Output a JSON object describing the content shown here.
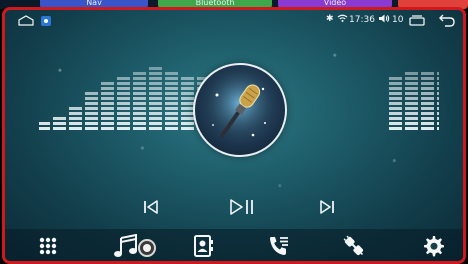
{
  "top_tabs": [
    {
      "label": "Nav"
    },
    {
      "label": "Bluetooth"
    },
    {
      "label": "Video"
    }
  ],
  "status_bar": {
    "time": "17:36",
    "volume_level": "10",
    "icons": [
      "home-icon",
      "app-badge-icon",
      "bluetooth-icon",
      "wifi-icon",
      "volume-icon",
      "recents-icon",
      "back-icon"
    ]
  },
  "player": {
    "album_art": "microphone-album-art",
    "controls": [
      "previous-track-icon",
      "play-pause-icon",
      "next-track-icon"
    ]
  },
  "dock": {
    "items": [
      "apps-grid-icon",
      "music-icon",
      "contacts-icon",
      "call-log-icon",
      "phone-link-icon",
      "settings-icon"
    ]
  },
  "colors": {
    "frame_border": "#d0191f",
    "background": "#1d5b68",
    "nav_tab": "#3a55c9",
    "bluetooth_tab": "#3fa84b",
    "video_tab": "#8a3bd1"
  }
}
